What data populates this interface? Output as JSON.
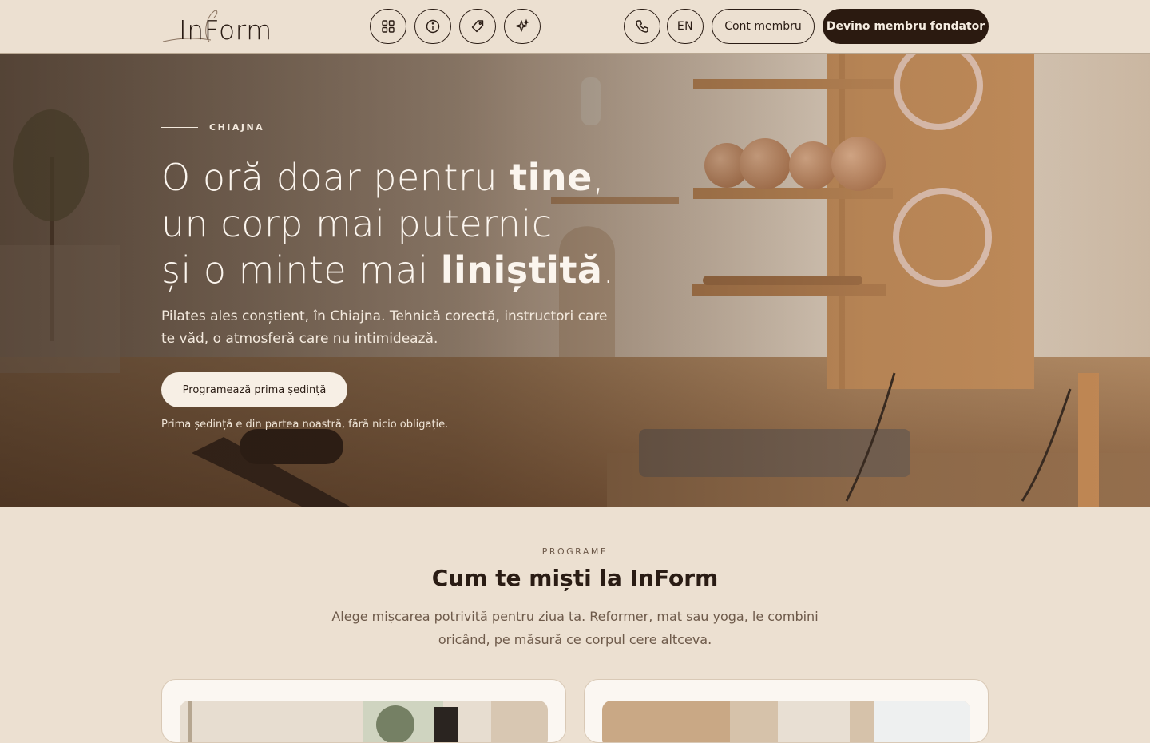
{
  "header": {
    "logo_text": "InForm",
    "icons": [
      "grid-icon",
      "info-icon",
      "tag-icon",
      "sparkle-icon",
      "phone-icon"
    ],
    "lang_label": "EN",
    "account_label": "Cont membru",
    "cta_label": "Devino membru fondator"
  },
  "hero": {
    "eyebrow": "CHIAJNA",
    "title_line1_a": "O oră doar pentru ",
    "title_line1_b": "tine",
    "title_line1_c": ",",
    "title_line2": "un corp mai puternic",
    "title_line3_a": "și o minte mai ",
    "title_line3_b": "liniștită",
    "title_line3_c": ".",
    "subtitle": "Pilates ales conștient, în Chiajna. Tehnică corectă, instructori care te văd, o atmosferă care nu intimidează.",
    "cta_label": "Programează prima ședință",
    "note": "Prima ședință e din partea noastră, fără nicio obligație."
  },
  "programs": {
    "eyebrow": "PROGRAME",
    "title": "Cum te miști la InForm",
    "description": "Alege mișcarea potrivită pentru ziua ta. Reformer, mat sau yoga, le combini oricând, pe măsură ce corpul cere altceva."
  },
  "colors": {
    "background": "#ece0d1",
    "dark": "#2b1a10",
    "text_muted": "#6e5a4a"
  }
}
